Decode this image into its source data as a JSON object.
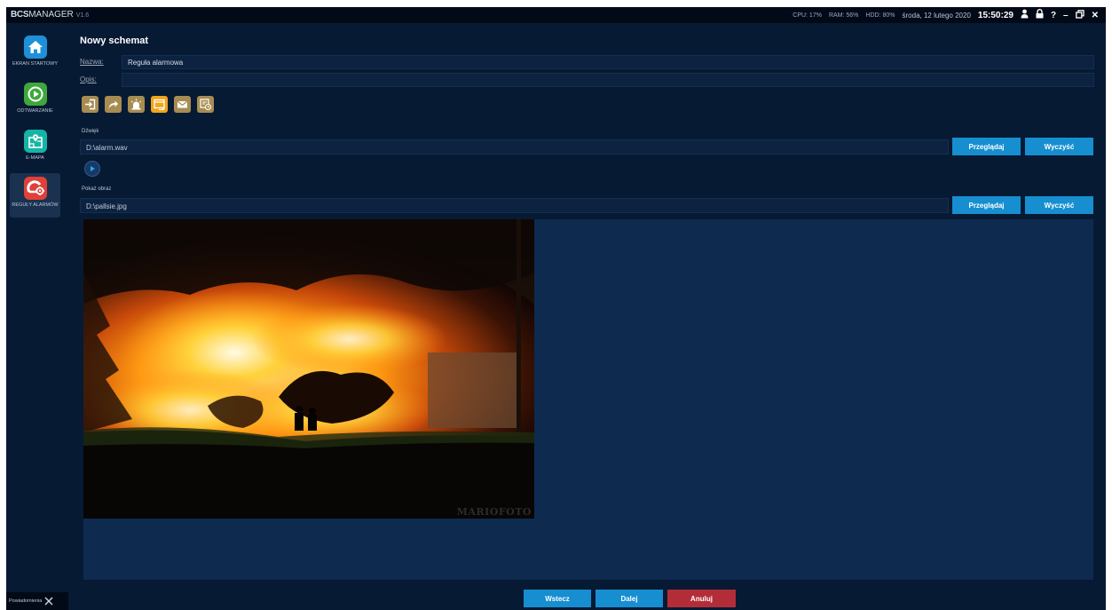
{
  "app": {
    "brand": "BCS",
    "name": "MANAGER",
    "version": "V1.6"
  },
  "system": {
    "cpu": "CPU: 17%",
    "ram": "RAM: 56%",
    "hdd": "HDD: 80%",
    "date": "środa, 12 lutego 2020",
    "time": "15:50:29"
  },
  "titlebar_icons": [
    "user-icon",
    "lock-icon",
    "help-icon",
    "minimize-icon",
    "restore-icon",
    "close-icon"
  ],
  "sidebar": {
    "items": [
      {
        "id": "home",
        "label": "EKRAN STARTOWY",
        "icon": "home-icon",
        "color": "#1e90d8"
      },
      {
        "id": "playback",
        "label": "ODTWARZANIE",
        "icon": "play-icon",
        "color": "#3ea83a"
      },
      {
        "id": "emap",
        "label": "E-MAPA",
        "icon": "map-icon",
        "color": "#15b5a6"
      },
      {
        "id": "alarm-rules",
        "label": "REGUŁY ALARMÓW",
        "icon": "alarm-rules-icon",
        "color": "#e0403a",
        "active": true
      }
    ]
  },
  "form": {
    "title": "Nowy schemat",
    "name_label": "Nazwa:",
    "name_value": "Reguła alarmowa",
    "desc_label": "Opis:",
    "desc_value": ""
  },
  "actions": [
    {
      "icon": "login-icon",
      "selected": false
    },
    {
      "icon": "share-arrow-icon",
      "selected": false
    },
    {
      "icon": "siren-icon",
      "selected": false
    },
    {
      "icon": "popup-window-icon",
      "selected": true
    },
    {
      "icon": "mail-icon",
      "selected": false
    },
    {
      "icon": "schedule-icon",
      "selected": false
    }
  ],
  "sound": {
    "label": "Dźwięk",
    "path": "D:\\alarm.wav",
    "browse_label": "Przeglądaj",
    "clear_label": "Wyczyść"
  },
  "image": {
    "label": "Pokaż obraz",
    "path": "D:\\pallsie.jpg",
    "browse_label": "Przeglądaj",
    "clear_label": "Wyczyść",
    "watermark": "MARIOFOTO"
  },
  "footer": {
    "back_label": "Wstecz",
    "next_label": "Dalej",
    "cancel_label": "Anuluj"
  },
  "notifications": {
    "label": "Powiadomienia"
  },
  "colors": {
    "background": "#071a33",
    "accent": "#168ed0",
    "cancel": "#b32d38",
    "action_icon": "#a78c52",
    "action_icon_selected": "#f2a51a"
  }
}
